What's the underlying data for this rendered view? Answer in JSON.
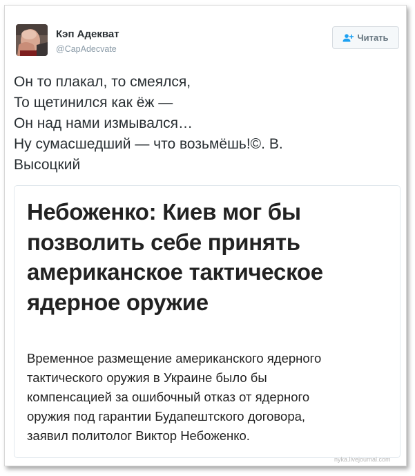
{
  "tweet": {
    "author": {
      "name": "Кэп Адекват",
      "handle": "@CapAdecvate"
    },
    "follow_button": {
      "label": "Читать",
      "icon": "follow-person-plus-icon"
    },
    "text_lines": [
      "Он то плакал, то смеялся,",
      "То щетинился как ёж —",
      "Он над нами измывался…",
      "Ну сумасшедший — что возьмёшь!©. В.",
      "Высоцкий"
    ]
  },
  "card": {
    "headline_lines": [
      "Небоженко: Киев мог бы",
      "позволить себе принять",
      "американское тактическое",
      "ядерное оружие"
    ],
    "summary_lines": [
      "Временное размещение американского ядерного",
      "тактического оружия в Украине было бы",
      "компенсацией за ошибочный отказ от ядерного",
      "оружия под гарантии Будапештского договора,",
      "заявил политолог Виктор Небоженко."
    ]
  },
  "watermark": "nyka.livejournal.com",
  "colors": {
    "text": "#292f33",
    "muted": "#8899a6",
    "button_bg": "#f5f8fa",
    "border": "#e1e8ed"
  }
}
